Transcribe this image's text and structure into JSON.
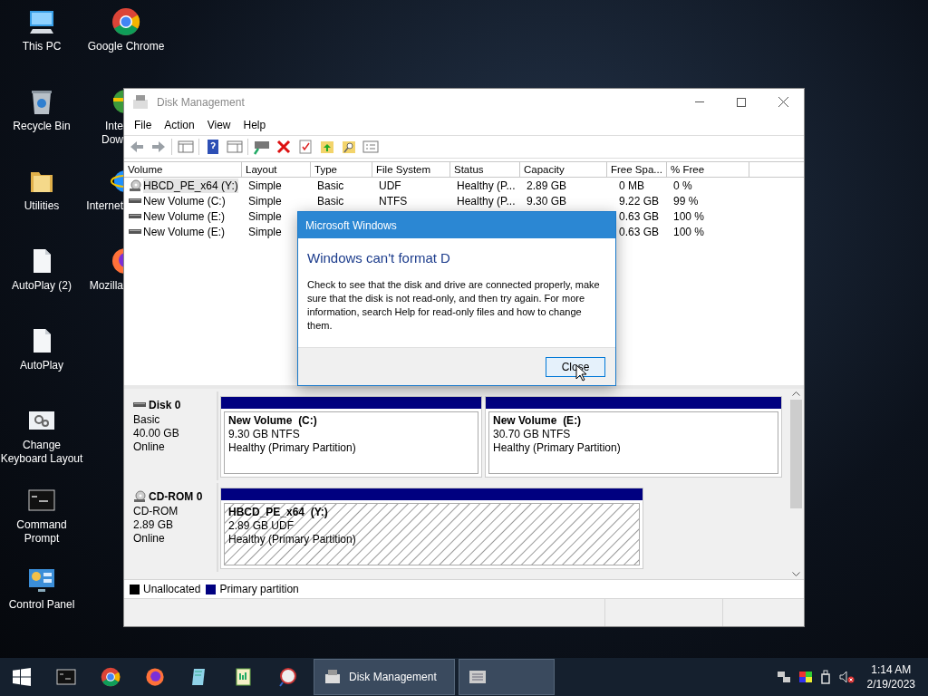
{
  "desktop": {
    "icons": [
      {
        "label": "This PC",
        "kind": "pc"
      },
      {
        "label": "Recycle Bin",
        "kind": "bin"
      },
      {
        "label": "Utilities",
        "kind": "folder"
      },
      {
        "label": "AutoPlay (2)",
        "kind": "file"
      },
      {
        "label": "AutoPlay",
        "kind": "file"
      },
      {
        "label": "Change Keyboard Layout",
        "kind": "keyboard"
      },
      {
        "label": "Command Prompt",
        "kind": "cmd"
      },
      {
        "label": "Control Panel",
        "kind": "control"
      }
    ],
    "column_2": [
      {
        "label": "Google Chrome",
        "kind": "chrome"
      },
      {
        "label": "Inte Dow",
        "kind": "idm"
      },
      {
        "label": "Internet",
        "kind": "ie"
      },
      {
        "label": "Mozilla",
        "kind": "firefox"
      }
    ]
  },
  "window": {
    "title": "Disk Management",
    "menu": [
      "File",
      "Action",
      "View",
      "Help"
    ],
    "toolbar": [
      {
        "kind": "back"
      },
      {
        "kind": "forward"
      },
      {
        "kind": "sep"
      },
      {
        "kind": "console"
      },
      {
        "kind": "sep"
      },
      {
        "kind": "help"
      },
      {
        "kind": "panel"
      },
      {
        "kind": "sep"
      },
      {
        "kind": "connect"
      },
      {
        "kind": "delete"
      },
      {
        "kind": "check"
      },
      {
        "kind": "folder-up"
      },
      {
        "kind": "folder-search"
      },
      {
        "kind": "list"
      }
    ],
    "table": {
      "columns": [
        "Volume",
        "Layout",
        "Type",
        "File System",
        "Status",
        "Capacity",
        "Free Spa...",
        "% Free"
      ],
      "rows": [
        {
          "kind": "cd",
          "selected": true,
          "cells": [
            "HBCD_PE_x64 (Y:)",
            "Simple",
            "Basic",
            "UDF",
            "Healthy (P...",
            "2.89 GB",
            "0 MB",
            "0 %"
          ]
        },
        {
          "kind": "disk",
          "selected": false,
          "cells": [
            "New Volume (C:)",
            "Simple",
            "Basic",
            "NTFS",
            "Healthy (P...",
            "9.30 GB",
            "9.22 GB",
            "99 %"
          ]
        },
        {
          "kind": "disk",
          "selected": false,
          "cells": [
            "New Volume (E:)",
            "Simple",
            null,
            null,
            null,
            null,
            "0.63 GB",
            "100 %"
          ]
        },
        {
          "kind": "disk",
          "selected": false,
          "cells": [
            "New Volume (E:)",
            "Simple",
            null,
            null,
            null,
            null,
            "0.63 GB",
            "100 %"
          ]
        }
      ]
    },
    "disks": [
      {
        "kind": "disk",
        "name": "Disk 0",
        "type": "Basic",
        "size": "40.00 GB",
        "state": "Online",
        "partitions": [
          {
            "name": "New Volume  (C:)",
            "size": "9.30 GB NTFS",
            "status": "Healthy (Primary Partition)",
            "hatched": false
          },
          {
            "name": "New Volume  (E:)",
            "size": "30.70 GB NTFS",
            "status": "Healthy (Primary Partition)",
            "hatched": false
          }
        ]
      },
      {
        "kind": "cd",
        "name": "CD-ROM 0",
        "type": "CD-ROM",
        "size": "2.89 GB",
        "state": "Online",
        "partitions": [
          {
            "name": "HBCD_PE_x64  (Y:)",
            "size": "2.89 GB UDF",
            "status": "Healthy (Primary Partition)",
            "hatched": true
          }
        ]
      }
    ],
    "legend": [
      {
        "label": "Unallocated",
        "color": "#000000"
      },
      {
        "label": "Primary partition",
        "color": "#000080"
      }
    ]
  },
  "dialog": {
    "title": "Microsoft Windows",
    "heading": "Windows can't format D",
    "message": "Check to see that the disk and drive are connected properly, make sure that the disk is not read-only, and then try again. For more information, search Help for read-only files and how to change them.",
    "button": "Close"
  },
  "taskbar": {
    "pinned": [
      {
        "kind": "cmd"
      },
      {
        "kind": "chrome"
      },
      {
        "kind": "firefox"
      },
      {
        "kind": "notepad"
      },
      {
        "kind": "editor"
      },
      {
        "kind": "sniffer"
      }
    ],
    "windows": [
      {
        "kind": "disk-mgmt",
        "label": "Disk Management"
      },
      {
        "kind": "list"
      }
    ],
    "tray": [
      {
        "kind": "network"
      },
      {
        "kind": "display"
      },
      {
        "kind": "usb"
      },
      {
        "kind": "volume-muted"
      }
    ],
    "time": "1:14 AM",
    "date": "2/19/2023"
  }
}
